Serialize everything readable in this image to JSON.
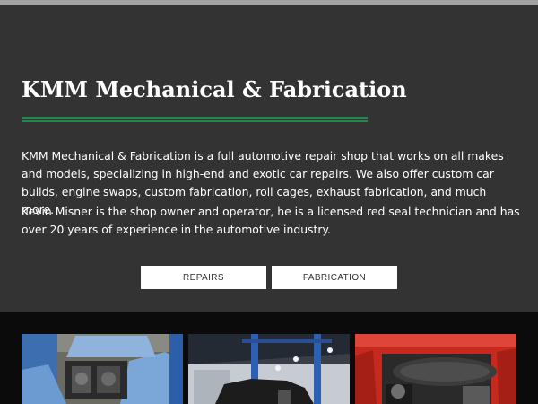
{
  "hero": {
    "title": "KMM Mechanical & Fabrication",
    "paragraph_1": "KMM Mechanical & Fabrication is a full automotive repair shop that works on all makes and models, specializing in high-end and exotic car repairs. We also offer custom car builds, engine swaps, custom fabrication, roll cages, exhaust fabrication, and much more.",
    "paragraph_2": "Kevin Misner is the shop owner and operator, he is a licensed red seal technician and has over 20 years of experience in the automotive industry.",
    "buttons": [
      {
        "label": "REPAIRS"
      },
      {
        "label": "FABRICATION"
      }
    ]
  },
  "colors": {
    "hero_background": "#333333",
    "accent_divider": "#1f8a4c",
    "button_background": "#ffffff",
    "page_background": "#000000"
  },
  "gallery": {
    "photos": [
      {
        "subject": "blue sports car engine bay",
        "icon": "photo-corvette-engine"
      },
      {
        "subject": "car on a lift in the shop",
        "icon": "photo-shop-lift"
      },
      {
        "subject": "red car engine with carbon fiber intake",
        "icon": "photo-red-engine"
      }
    ]
  }
}
